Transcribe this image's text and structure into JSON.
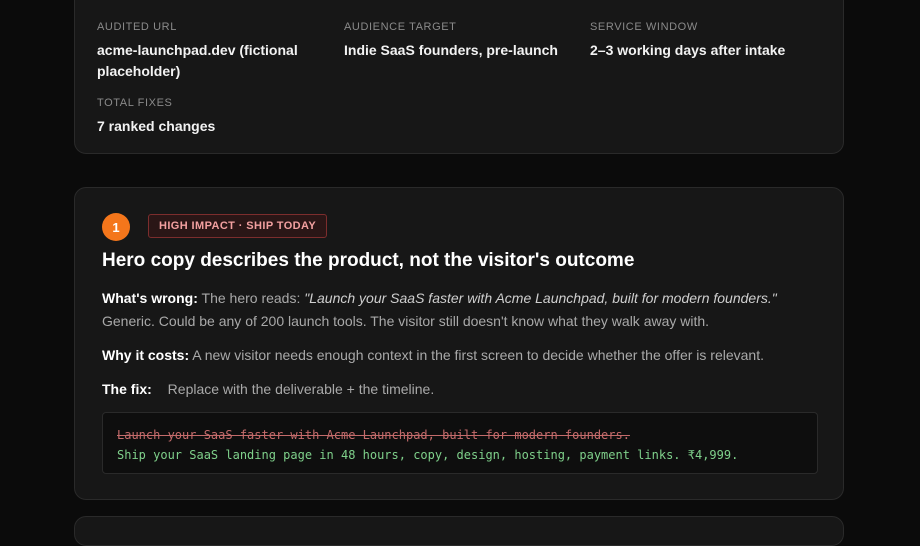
{
  "summary": {
    "audited_url": {
      "label": "AUDITED URL",
      "value": "acme-launchpad.dev (fictional placeholder)"
    },
    "audience": {
      "label": "AUDIENCE TARGET",
      "value": "Indie SaaS founders, pre-launch"
    },
    "service_window": {
      "label": "SERVICE WINDOW",
      "value": "2–3 working days after intake"
    },
    "total_fixes": {
      "label": "TOTAL FIXES",
      "value": "7 ranked changes"
    }
  },
  "issue": {
    "number": "1",
    "tag": "HIGH IMPACT · SHIP TODAY",
    "title": "Hero copy describes the product, not the visitor's outcome",
    "whats_wrong_label": "What's wrong:",
    "whats_wrong_intro": "The hero reads:",
    "whats_wrong_quote": "\"Launch your SaaS faster with Acme Launchpad, built for modern founders.\"",
    "whats_wrong_rest": "Generic. Could be any of 200 launch tools. The visitor still doesn't know what they walk away with.",
    "why_label": "Why it costs:",
    "why_text": "A new visitor needs enough context in the first screen to decide whether the offer is relevant.",
    "fix_label": "The fix:",
    "fix_text": "Replace with the deliverable + the timeline.",
    "code_old": "Launch your SaaS faster with Acme Launchpad, built for modern founders.",
    "code_new": "Ship your SaaS landing page in 48 hours, copy, design, hosting, payment links. ₹4,999."
  },
  "colors": {
    "accent": "#f4761b",
    "tag_border": "#7c2d2d",
    "removed": "#c46b6b",
    "added": "#7fd18b"
  }
}
